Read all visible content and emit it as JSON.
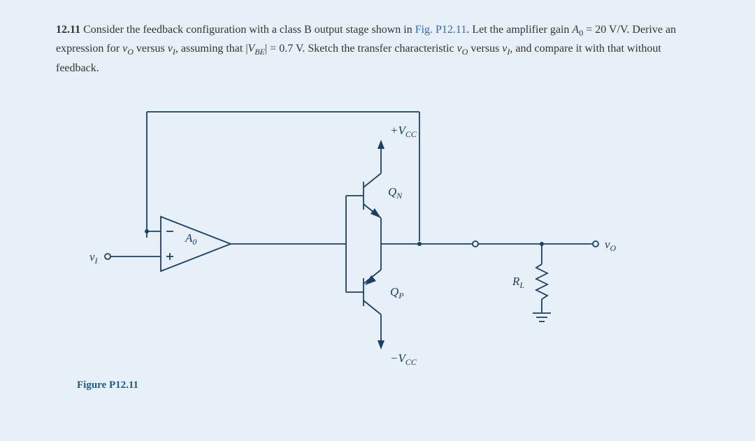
{
  "problem": {
    "number": "12.11",
    "intro": "Consider the feedback configuration with a class B output stage shown in ",
    "fig_ref": "Fig. P12.11",
    "after_fig": ". Let the amplifier gain ",
    "a0": "A",
    "a0_sub": "0",
    "gain_val": " = 20 V/V. Derive an expression for ",
    "vo": "v",
    "vo_sub": "O",
    "mid1": " versus ",
    "vi": "v",
    "vi_sub": "I",
    "mid2": ", assuming that |",
    "vbe": "V",
    "vbe_sub": "BE",
    "vbe_val": "| = 0.7 V. Sketch the transfer characteristic ",
    "end1": " versus ",
    "end2": ", and compare it with that without feedback."
  },
  "circuit": {
    "vcc_pos": "+V",
    "vcc_pos_sub": "CC",
    "vcc_neg": "−V",
    "vcc_neg_sub": "CC",
    "qn": "Q",
    "qn_sub": "N",
    "qp": "Q",
    "qp_sub": "P",
    "a0": "A",
    "a0_sub": "0",
    "vi": "v",
    "vi_sub": "I",
    "vo": "v",
    "vo_sub": "O",
    "rl": "R",
    "rl_sub": "L"
  },
  "figure_label": "Figure P12.11"
}
